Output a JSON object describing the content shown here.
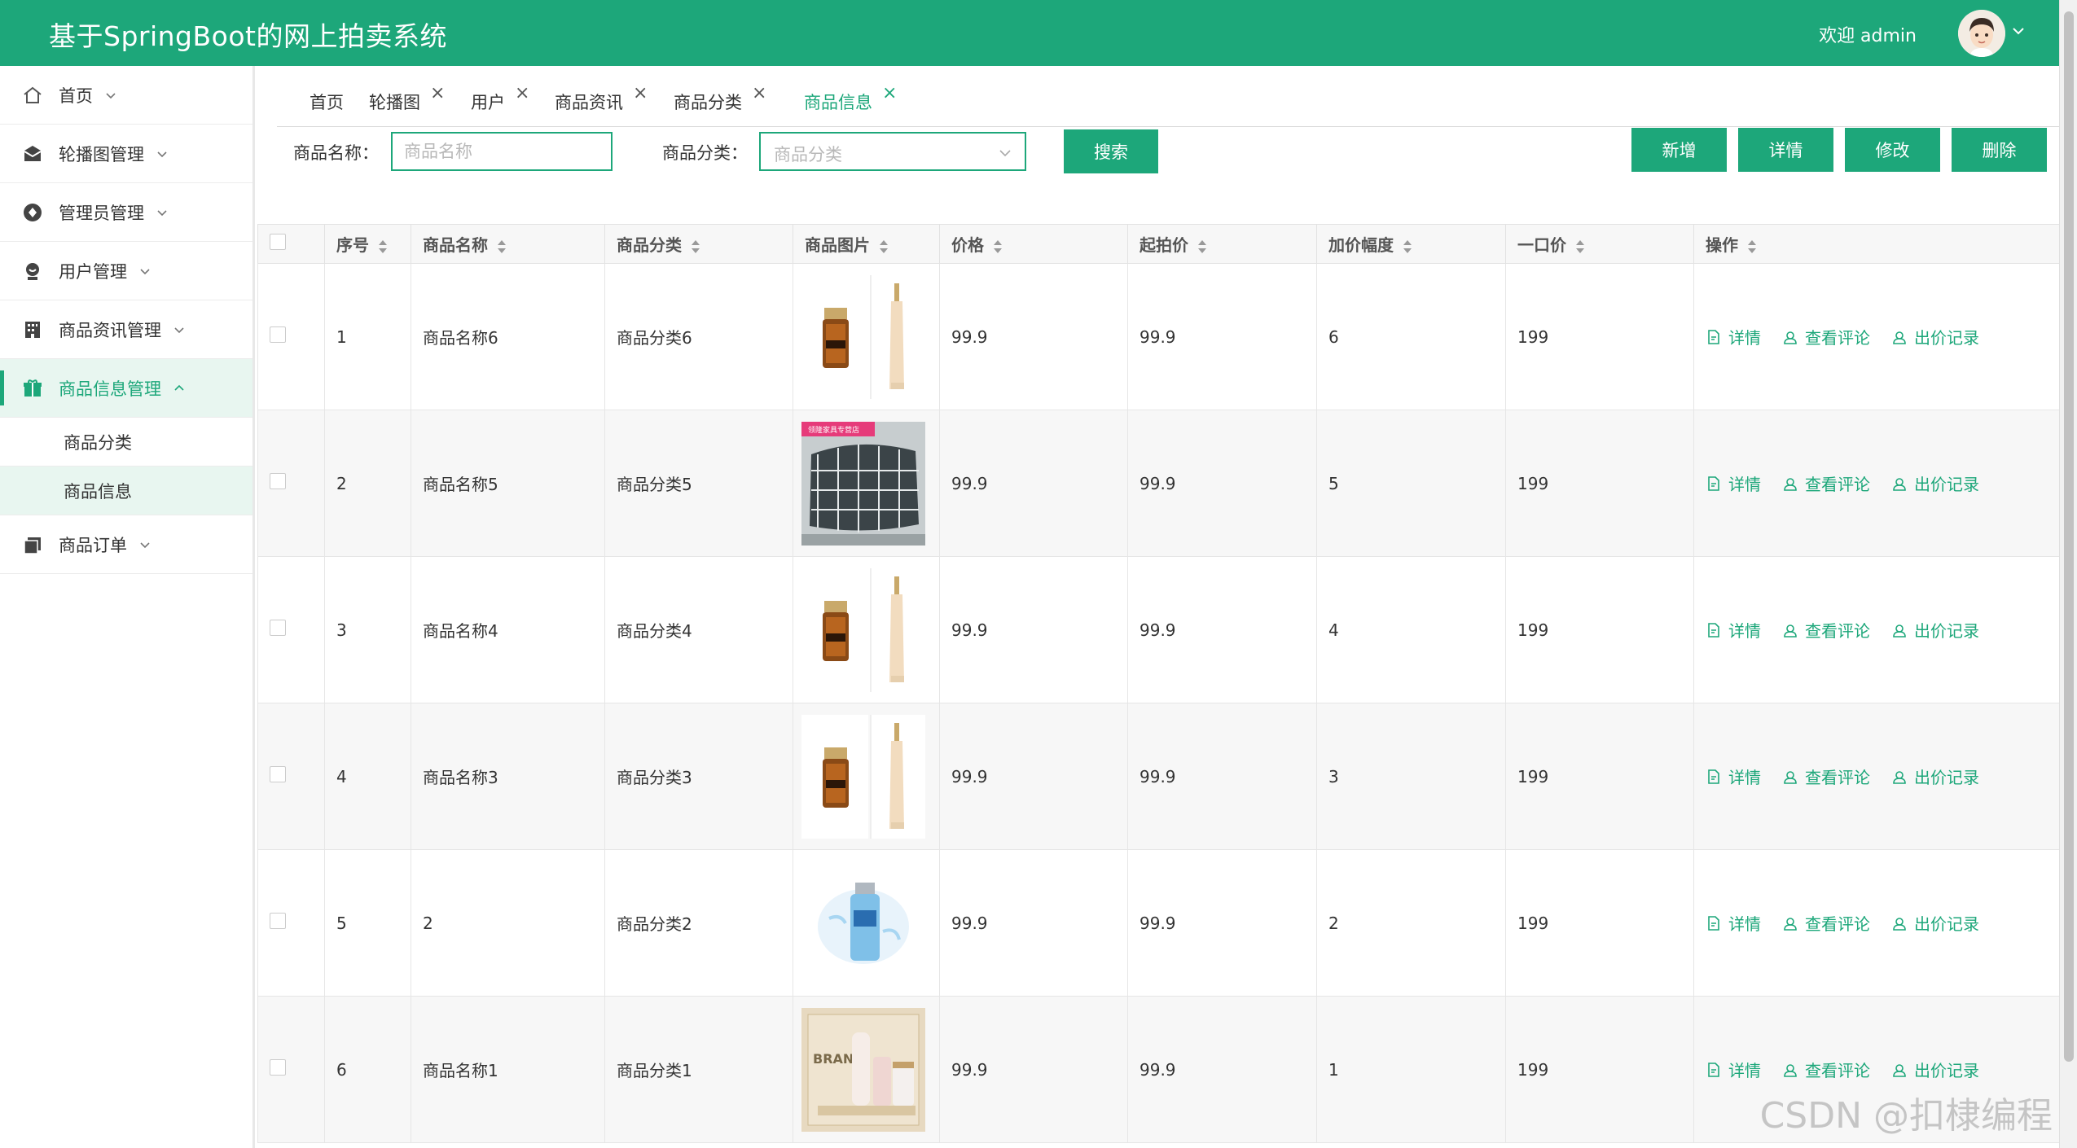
{
  "header": {
    "title": "基于SpringBoot的网上拍卖系统",
    "welcome": "欢迎 admin"
  },
  "sidebar": {
    "items": [
      {
        "label": "首页",
        "icon": "home-icon"
      },
      {
        "label": "轮播图管理",
        "icon": "envelope-icon"
      },
      {
        "label": "管理员管理",
        "icon": "admin-icon"
      },
      {
        "label": "用户管理",
        "icon": "user-icon"
      },
      {
        "label": "商品资讯管理",
        "icon": "building-icon"
      },
      {
        "label": "商品信息管理",
        "icon": "gift-icon"
      },
      {
        "label": "商品订单",
        "icon": "order-icon"
      }
    ],
    "sub_items": [
      "商品分类",
      "商品信息"
    ]
  },
  "tabs": [
    {
      "label": "首页",
      "closable": false
    },
    {
      "label": "轮播图",
      "closable": true
    },
    {
      "label": "用户",
      "closable": true
    },
    {
      "label": "商品资讯",
      "closable": true
    },
    {
      "label": "商品分类",
      "closable": true
    },
    {
      "label": "商品信息",
      "closable": true,
      "active": true
    }
  ],
  "search": {
    "name_label": "商品名称：",
    "name_placeholder": "商品名称",
    "category_label": "商品分类：",
    "category_placeholder": "商品分类",
    "search_button": "搜索"
  },
  "actions": {
    "add": "新增",
    "detail": "详情",
    "edit": "修改",
    "delete": "删除"
  },
  "table": {
    "columns": [
      "序号",
      "商品名称",
      "商品分类",
      "商品图片",
      "价格",
      "起拍价",
      "加价幅度",
      "一口价",
      "操作"
    ],
    "row_actions": [
      "详情",
      "查看评论",
      "出价记录"
    ],
    "rows": [
      {
        "index": "1",
        "name": "商品名称6",
        "category": "商品分类6",
        "image": "serum-bottles",
        "price": "99.9",
        "start_price": "99.9",
        "increment": "6",
        "buy_now": "199"
      },
      {
        "index": "2",
        "name": "商品名称5",
        "category": "商品分类5",
        "image": "pillow",
        "image_text": "领隆家具专营店",
        "price": "99.9",
        "start_price": "99.9",
        "increment": "5",
        "buy_now": "199"
      },
      {
        "index": "3",
        "name": "商品名称4",
        "category": "商品分类4",
        "image": "serum-bottles",
        "price": "99.9",
        "start_price": "99.9",
        "increment": "4",
        "buy_now": "199"
      },
      {
        "index": "4",
        "name": "商品名称3",
        "category": "商品分类3",
        "image": "serum-bottles",
        "price": "99.9",
        "start_price": "99.9",
        "increment": "3",
        "buy_now": "199"
      },
      {
        "index": "5",
        "name": "2",
        "category": "商品分类2",
        "image": "lotion-bottle",
        "price": "99.9",
        "start_price": "99.9",
        "increment": "2",
        "buy_now": "199"
      },
      {
        "index": "6",
        "name": "商品名称1",
        "category": "商品分类1",
        "image": "brand-cosmetics",
        "image_text": "BRAND",
        "price": "99.9",
        "start_price": "99.9",
        "increment": "1",
        "buy_now": "199"
      }
    ]
  },
  "watermark": "CSDN @扣棣编程",
  "colors": {
    "primary": "#1da77a",
    "active_bg": "#e8f6f0"
  }
}
